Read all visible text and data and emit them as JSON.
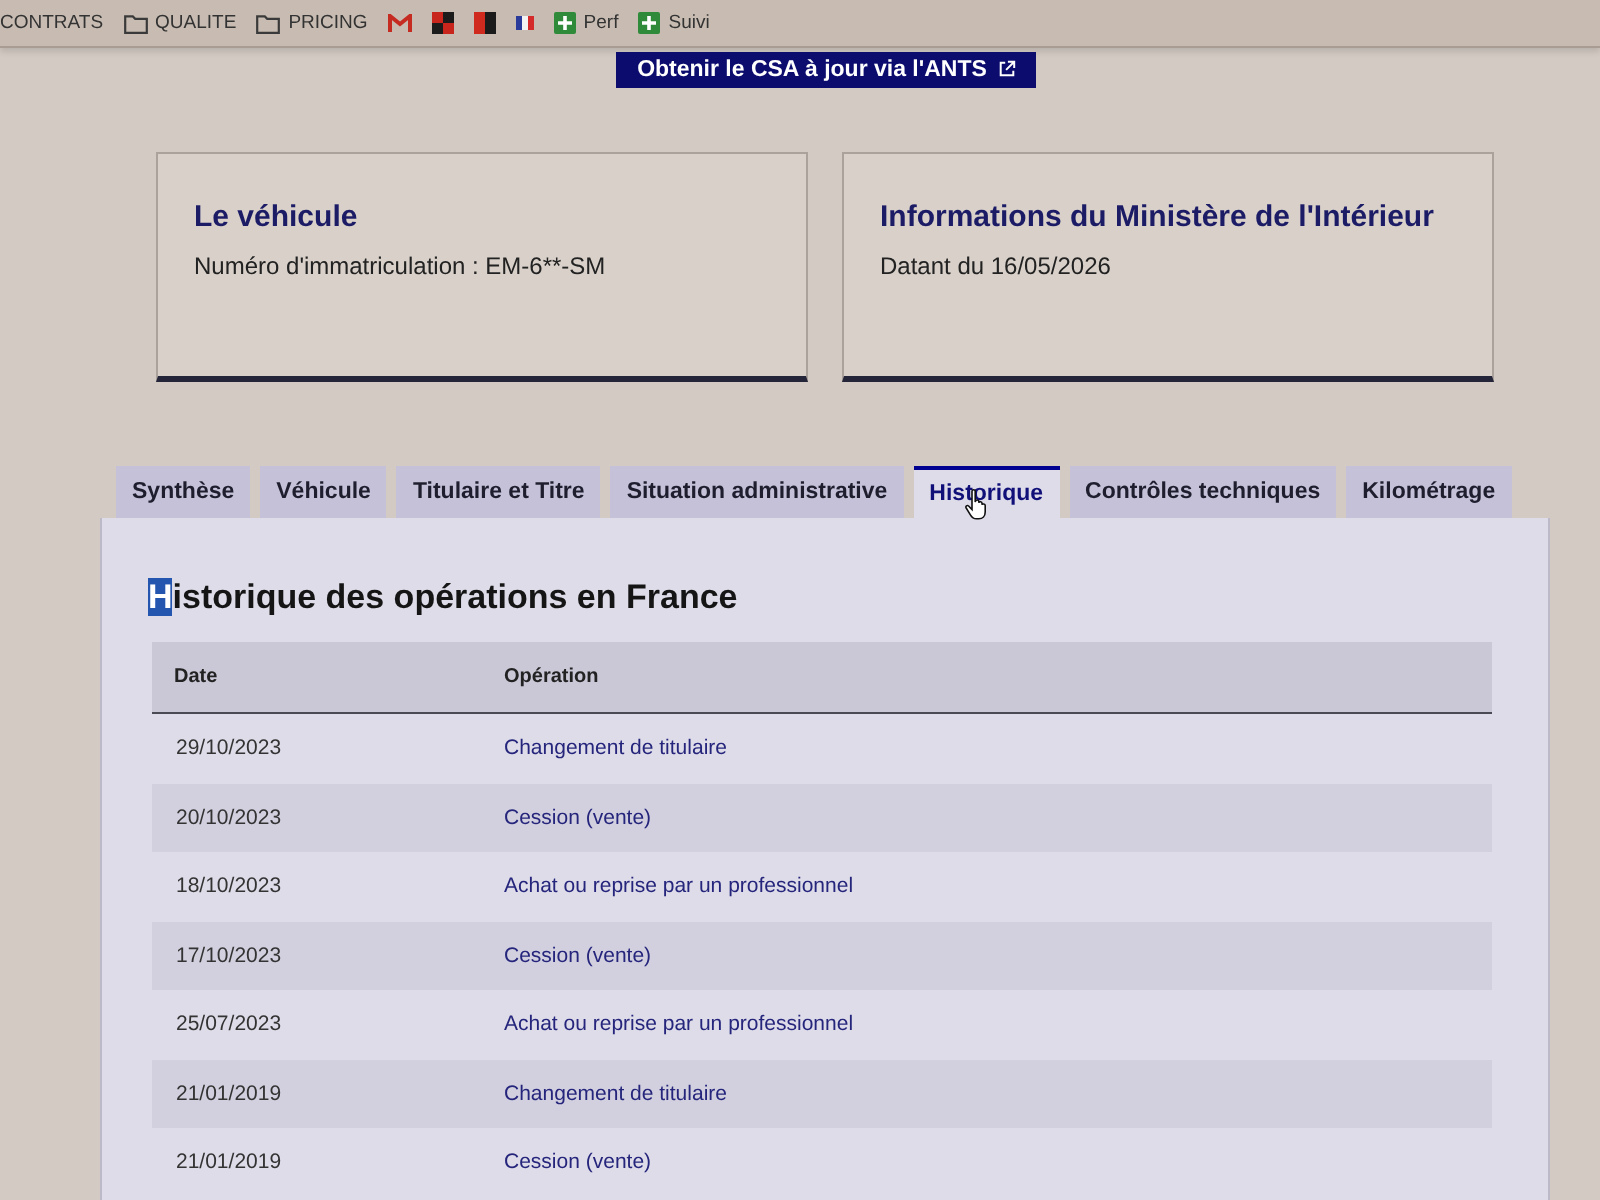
{
  "bookmarks_bar": {
    "items": [
      {
        "kind": "text",
        "label": "CONTRATS"
      },
      {
        "kind": "folder",
        "label": "QUALITE"
      },
      {
        "kind": "folder",
        "label": "PRICING"
      },
      {
        "kind": "mail"
      },
      {
        "kind": "checker"
      },
      {
        "kind": "split"
      },
      {
        "kind": "flag"
      },
      {
        "kind": "plus",
        "label": "Perf"
      },
      {
        "kind": "plus",
        "label": "Suivi"
      }
    ]
  },
  "csa_button": {
    "label": "Obtenir le CSA à jour via l'ANTS",
    "external": true
  },
  "cards": [
    {
      "title": "Le véhicule",
      "text": "Numéro d'immatriculation : EM-6**-SM"
    },
    {
      "title": "Informations du Ministère de l'Intérieur",
      "text": "Datant du 16/05/2026"
    }
  ],
  "tabs": [
    {
      "label": "Synthèse",
      "selected": false,
      "hovered": false
    },
    {
      "label": "Véhicule",
      "selected": false,
      "hovered": false
    },
    {
      "label": "Titulaire et Titre",
      "selected": false,
      "hovered": false
    },
    {
      "label": "Situation administrative",
      "selected": false,
      "hovered": false
    },
    {
      "label": "Historique",
      "selected": true,
      "hovered": true
    },
    {
      "label": "Contrôles techniques",
      "selected": false,
      "hovered": false
    },
    {
      "label": "Kilométrage",
      "selected": false,
      "hovered": false
    }
  ],
  "panel": {
    "heading": "Historique des opérations en France",
    "heading_first_letter_highlighted": true,
    "table": {
      "columns": [
        "Date",
        "Opération"
      ],
      "rows": [
        {
          "date": "29/10/2023",
          "operation": "Changement de titulaire"
        },
        {
          "date": "20/10/2023",
          "operation": "Cession (vente)"
        },
        {
          "date": "18/10/2023",
          "operation": "Achat ou reprise par un professionnel"
        },
        {
          "date": "17/10/2023",
          "operation": "Cession (vente)"
        },
        {
          "date": "25/07/2023",
          "operation": "Achat ou reprise par un professionnel"
        },
        {
          "date": "21/01/2019",
          "operation": "Changement de titulaire"
        },
        {
          "date": "21/01/2019",
          "operation": "Cession (vente)"
        }
      ]
    }
  }
}
